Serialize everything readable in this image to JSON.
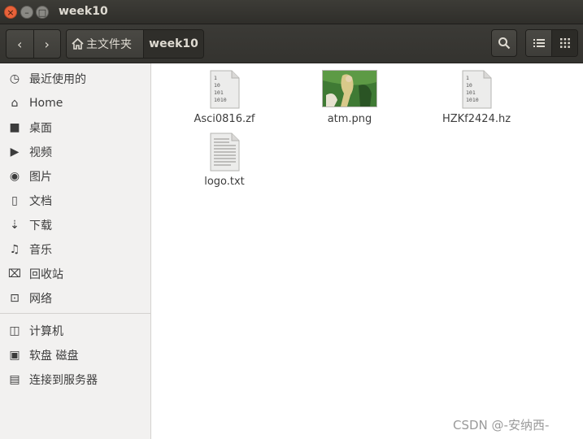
{
  "window": {
    "title": "week10",
    "buttons": {
      "close": "×",
      "minimize": "–",
      "maximize": "□"
    }
  },
  "toolbar": {
    "back_icon": "‹",
    "forward_icon": "›",
    "breadcrumb": {
      "home_label": "主文件夹",
      "current_label": "week10"
    }
  },
  "sidebar": {
    "items": [
      {
        "label": "最近使用的",
        "icon": "clock-icon",
        "glyph": "◷"
      },
      {
        "label": "Home",
        "icon": "home-icon",
        "glyph": "⌂"
      },
      {
        "label": "桌面",
        "icon": "folder-icon",
        "glyph": "■"
      },
      {
        "label": "视频",
        "icon": "video-icon",
        "glyph": "▶"
      },
      {
        "label": "图片",
        "icon": "camera-icon",
        "glyph": "◉"
      },
      {
        "label": "文档",
        "icon": "document-icon",
        "glyph": "▯"
      },
      {
        "label": "下载",
        "icon": "download-icon",
        "glyph": "⇣"
      },
      {
        "label": "音乐",
        "icon": "music-icon",
        "glyph": "♫"
      },
      {
        "label": "回收站",
        "icon": "trash-icon",
        "glyph": "⌧"
      },
      {
        "label": "网络",
        "icon": "network-icon",
        "glyph": "⊡"
      }
    ],
    "devices": [
      {
        "label": "计算机",
        "icon": "computer-icon",
        "glyph": "◫"
      },
      {
        "label": "软盘 磁盘",
        "icon": "drive-icon",
        "glyph": "▣"
      },
      {
        "label": "连接到服务器",
        "icon": "server-icon",
        "glyph": "▤"
      }
    ]
  },
  "files": [
    {
      "name": "Asci0816.zf",
      "type": "binary"
    },
    {
      "name": "atm.png",
      "type": "image"
    },
    {
      "name": "HZKf2424.hz",
      "type": "binary"
    },
    {
      "name": "logo.txt",
      "type": "text"
    }
  ],
  "binary_icon_lines": [
    "1",
    "10",
    "101",
    "1010"
  ],
  "watermark": "CSDN @-安纳西-"
}
